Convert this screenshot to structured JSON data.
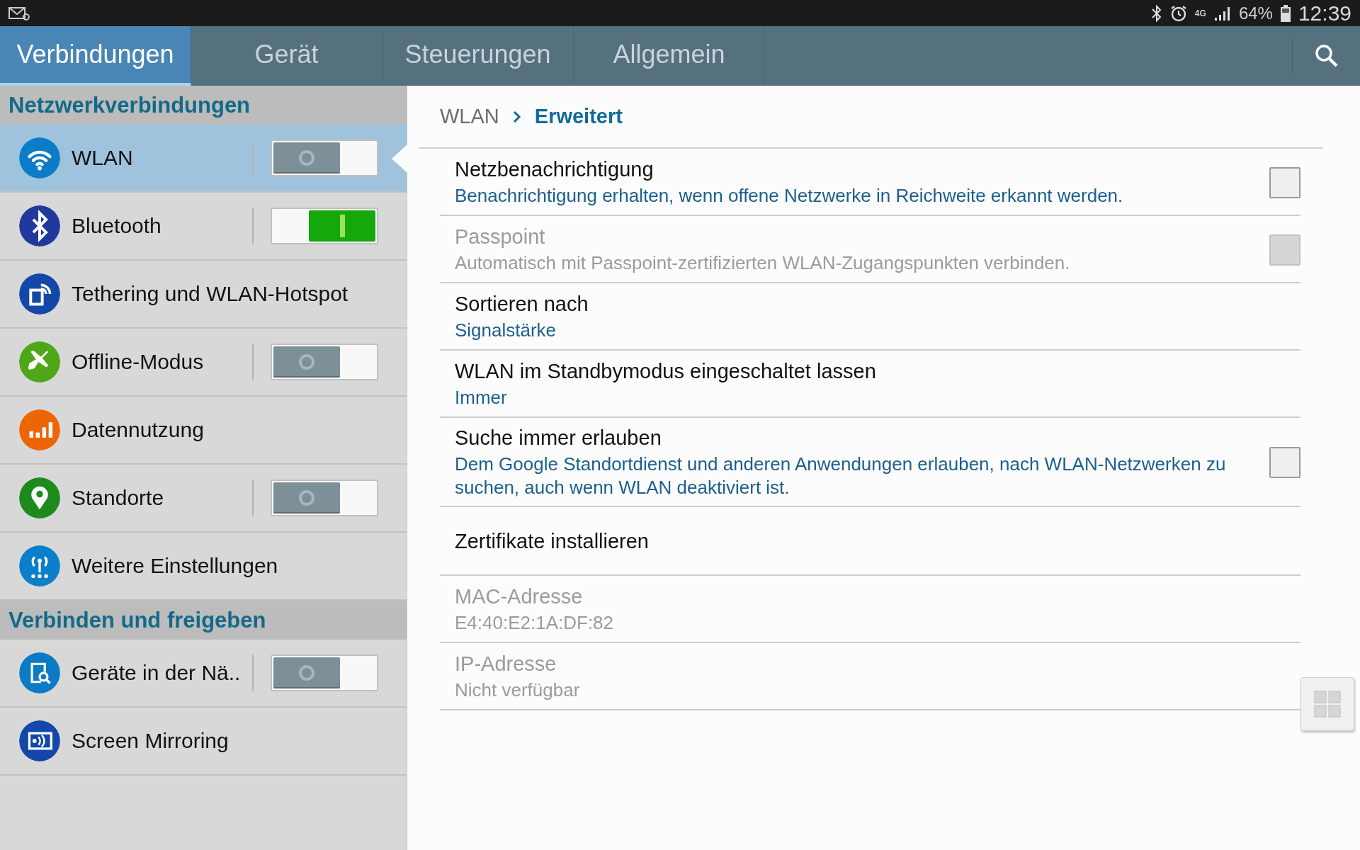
{
  "status_bar": {
    "network": "4G",
    "battery": "64%",
    "time": "12:39"
  },
  "tabs": [
    {
      "label": "Verbindungen",
      "selected": true
    },
    {
      "label": "Gerät",
      "selected": false
    },
    {
      "label": "Steuerungen",
      "selected": false
    },
    {
      "label": "Allgemein",
      "selected": false
    }
  ],
  "sidebar": {
    "sections": [
      {
        "title": "Netzwerkverbindungen",
        "items": [
          {
            "label": "WLAN",
            "color": "#0a7cc8",
            "kind": "toggle",
            "on": false,
            "selected": true
          },
          {
            "label": "Bluetooth",
            "color": "#1f3a9c",
            "kind": "toggle",
            "on": true,
            "selected": false
          },
          {
            "label": "Tethering und WLAN-Hotspot",
            "color": "#1448a8",
            "kind": "link",
            "selected": false
          },
          {
            "label": "Offline-Modus",
            "color": "#4ea718",
            "kind": "toggle",
            "on": false,
            "selected": false
          },
          {
            "label": "Datennutzung",
            "color": "#ee6506",
            "kind": "link",
            "selected": false
          },
          {
            "label": "Standorte",
            "color": "#1c8a1c",
            "kind": "toggle",
            "on": false,
            "selected": false
          },
          {
            "label": "Weitere Einstellungen",
            "color": "#0b7fc9",
            "kind": "link",
            "selected": false
          }
        ]
      },
      {
        "title": "Verbinden und freigeben",
        "items": [
          {
            "label": "Geräte in der Nä..",
            "color": "#0b7bc6",
            "kind": "toggle",
            "on": false,
            "selected": false
          },
          {
            "label": "Screen Mirroring",
            "color": "#1448a8",
            "kind": "link",
            "selected": false
          }
        ]
      }
    ]
  },
  "breadcrumb": {
    "parent": "WLAN",
    "current": "Erweitert"
  },
  "settings": [
    {
      "kind": "checkbox",
      "title": "Netzbenachrichtigung",
      "subtitle": "Benachrichtigung erhalten, wenn offene Netzwerke in Reichweite erkannt werden.",
      "checked": false,
      "disabled": false
    },
    {
      "kind": "checkbox",
      "title": "Passpoint",
      "subtitle": "Automatisch mit Passpoint-zertifizierten WLAN-Zugangspunkten verbinden.",
      "checked": false,
      "disabled": true
    },
    {
      "kind": "value",
      "title": "Sortieren nach",
      "subtitle": "Signalstärke",
      "disabled": false
    },
    {
      "kind": "value",
      "title": "WLAN im Standbymodus eingeschaltet lassen",
      "subtitle": "Immer",
      "disabled": false
    },
    {
      "kind": "checkbox",
      "title": "Suche immer erlauben",
      "subtitle": "Dem Google Standortdienst und anderen Anwendungen erlauben, nach WLAN-Netzwerken zu suchen, auch wenn WLAN deaktiviert ist.",
      "checked": false,
      "disabled": false
    },
    {
      "kind": "action",
      "title": "Zertifikate installieren",
      "disabled": false
    },
    {
      "kind": "value",
      "title": "MAC-Adresse",
      "subtitle": "E4:40:E2:1A:DF:82",
      "disabled": true
    },
    {
      "kind": "value",
      "title": "IP-Adresse",
      "subtitle": "Nicht verfügbar",
      "disabled": true
    }
  ]
}
